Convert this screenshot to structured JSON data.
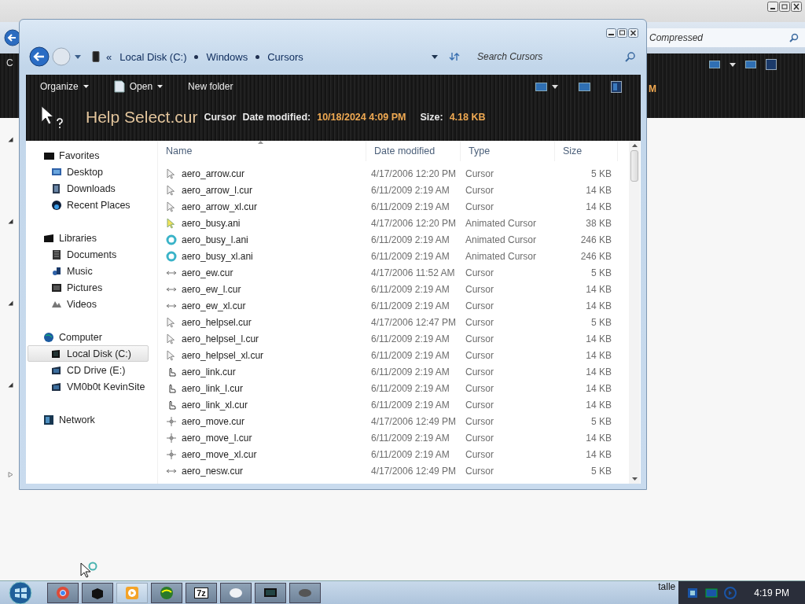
{
  "background_window": {
    "search_placeholder": "Compressed",
    "tree_fragment": "C",
    "toolbar_fragment": "M"
  },
  "address": {
    "overflow": "«",
    "crumbs": [
      "Local Disk (C:)",
      "Windows",
      "Cursors"
    ]
  },
  "search": {
    "placeholder": "Search Cursors"
  },
  "toolbar": {
    "commands": [
      {
        "label": "Organize",
        "kind": "menu"
      },
      {
        "label": "Open",
        "kind": "icon-menu"
      },
      {
        "label": "New folder",
        "kind": "plain"
      }
    ]
  },
  "details": {
    "name": "Help Select.cur",
    "type": "Cursor",
    "fields": [
      {
        "label": "Date modified:",
        "value": "10/18/2024 4:09 PM"
      },
      {
        "label": "Size:",
        "value": "4.18 KB"
      }
    ]
  },
  "navigation": [
    {
      "label": "Favorites",
      "selected": false,
      "children": [
        {
          "label": "Desktop",
          "selected": false
        },
        {
          "label": "Downloads",
          "selected": false
        },
        {
          "label": "Recent Places",
          "selected": false
        }
      ]
    },
    {
      "label": "Libraries",
      "selected": false,
      "children": [
        {
          "label": "Documents",
          "selected": false
        },
        {
          "label": "Music",
          "selected": false
        },
        {
          "label": "Pictures",
          "selected": false
        },
        {
          "label": "Videos",
          "selected": false
        }
      ]
    },
    {
      "label": "Computer",
      "selected": false,
      "children": [
        {
          "label": "Local Disk (C:)",
          "selected": true
        },
        {
          "label": "CD Drive (E:)",
          "selected": false
        },
        {
          "label": "VM0b0t KevinSite",
          "selected": false
        }
      ]
    },
    {
      "label": "Network",
      "selected": false
    }
  ],
  "table": {
    "columns": [
      {
        "label": "Name",
        "sorted": true
      },
      {
        "label": "Date modified",
        "sorted": false
      },
      {
        "label": "Type",
        "sorted": false
      },
      {
        "label": "Size",
        "sorted": false
      }
    ],
    "rows": [
      {
        "kind": "arrow",
        "name": "aero_arrow.cur",
        "date": "4/17/2006 12:20 PM",
        "type": "Cursor",
        "size": "5 KB"
      },
      {
        "kind": "arrow",
        "name": "aero_arrow_l.cur",
        "date": "6/11/2009 2:19 AM",
        "type": "Cursor",
        "size": "14 KB"
      },
      {
        "kind": "arrow",
        "name": "aero_arrow_xl.cur",
        "date": "6/11/2009 2:19 AM",
        "type": "Cursor",
        "size": "14 KB"
      },
      {
        "kind": "busy",
        "name": "aero_busy.ani",
        "date": "4/17/2006 12:20 PM",
        "type": "Animated Cursor",
        "size": "38 KB"
      },
      {
        "kind": "ring",
        "name": "aero_busy_l.ani",
        "date": "6/11/2009 2:19 AM",
        "type": "Animated Cursor",
        "size": "246 KB"
      },
      {
        "kind": "ring",
        "name": "aero_busy_xl.ani",
        "date": "6/11/2009 2:19 AM",
        "type": "Animated Cursor",
        "size": "246 KB"
      },
      {
        "kind": "resize",
        "name": "aero_ew.cur",
        "date": "4/17/2006 11:52 AM",
        "type": "Cursor",
        "size": "5 KB"
      },
      {
        "kind": "resize",
        "name": "aero_ew_l.cur",
        "date": "6/11/2009 2:19 AM",
        "type": "Cursor",
        "size": "14 KB"
      },
      {
        "kind": "resize",
        "name": "aero_ew_xl.cur",
        "date": "6/11/2009 2:19 AM",
        "type": "Cursor",
        "size": "14 KB"
      },
      {
        "kind": "arrow",
        "name": "aero_helpsel.cur",
        "date": "4/17/2006 12:47 PM",
        "type": "Cursor",
        "size": "5 KB"
      },
      {
        "kind": "arrow",
        "name": "aero_helpsel_l.cur",
        "date": "6/11/2009 2:19 AM",
        "type": "Cursor",
        "size": "14 KB"
      },
      {
        "kind": "arrow",
        "name": "aero_helpsel_xl.cur",
        "date": "6/11/2009 2:19 AM",
        "type": "Cursor",
        "size": "14 KB"
      },
      {
        "kind": "hand",
        "name": "aero_link.cur",
        "date": "6/11/2009 2:19 AM",
        "type": "Cursor",
        "size": "14 KB"
      },
      {
        "kind": "hand",
        "name": "aero_link_l.cur",
        "date": "6/11/2009 2:19 AM",
        "type": "Cursor",
        "size": "14 KB"
      },
      {
        "kind": "hand",
        "name": "aero_link_xl.cur",
        "date": "6/11/2009 2:19 AM",
        "type": "Cursor",
        "size": "14 KB"
      },
      {
        "kind": "move",
        "name": "aero_move.cur",
        "date": "4/17/2006 12:49 PM",
        "type": "Cursor",
        "size": "5 KB"
      },
      {
        "kind": "move",
        "name": "aero_move_l.cur",
        "date": "6/11/2009 2:19 AM",
        "type": "Cursor",
        "size": "14 KB"
      },
      {
        "kind": "move",
        "name": "aero_move_xl.cur",
        "date": "6/11/2009 2:19 AM",
        "type": "Cursor",
        "size": "14 KB"
      },
      {
        "kind": "resize",
        "name": "aero_nesw.cur",
        "date": "4/17/2006 12:49 PM",
        "type": "Cursor",
        "size": "5 KB"
      }
    ]
  },
  "taskbar": {
    "items": [
      {
        "kind": "browser",
        "selected": false
      },
      {
        "kind": "box",
        "selected": false
      },
      {
        "kind": "media",
        "selected": true
      },
      {
        "kind": "globe",
        "selected": false
      },
      {
        "kind": "archive",
        "selected": false
      },
      {
        "kind": "disc",
        "selected": false
      },
      {
        "kind": "monitor",
        "selected": false
      },
      {
        "kind": "mouse",
        "selected": false
      }
    ],
    "archive_label": "7z",
    "tray_fragment": "talle",
    "clock": "4:19 PM"
  }
}
